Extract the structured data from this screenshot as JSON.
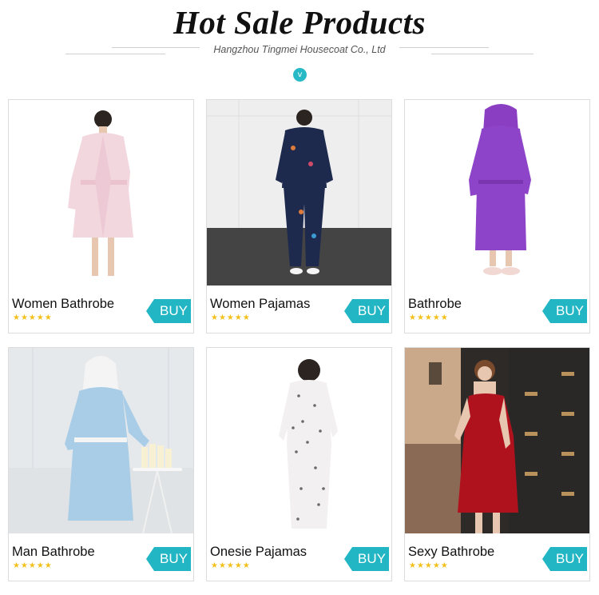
{
  "header": {
    "title": "Hot Sale Products",
    "subtitle": "Hangzhou Tingmei Housecoat Co., Ltd",
    "chevron": "v"
  },
  "colors": {
    "accent": "#22b6c4",
    "star": "#f3c01b"
  },
  "products": [
    {
      "name": "Women Bathrobe",
      "buy_label": "BUY",
      "rating_stars": "★★★★★",
      "rating": 5
    },
    {
      "name": "Women Pajamas",
      "buy_label": "BUY",
      "rating_stars": "★★★★★",
      "rating": 5
    },
    {
      "name": "Bathrobe",
      "buy_label": "BUY",
      "rating_stars": "★★★★★",
      "rating": 5
    },
    {
      "name": "Man Bathrobe",
      "buy_label": "BUY",
      "rating_stars": "★★★★★",
      "rating": 5
    },
    {
      "name": "Onesie Pajamas",
      "buy_label": "BUY",
      "rating_stars": "★★★★★",
      "rating": 5
    },
    {
      "name": "Sexy Bathrobe",
      "buy_label": "BUY",
      "rating_stars": "★★★★★",
      "rating": 5
    }
  ]
}
